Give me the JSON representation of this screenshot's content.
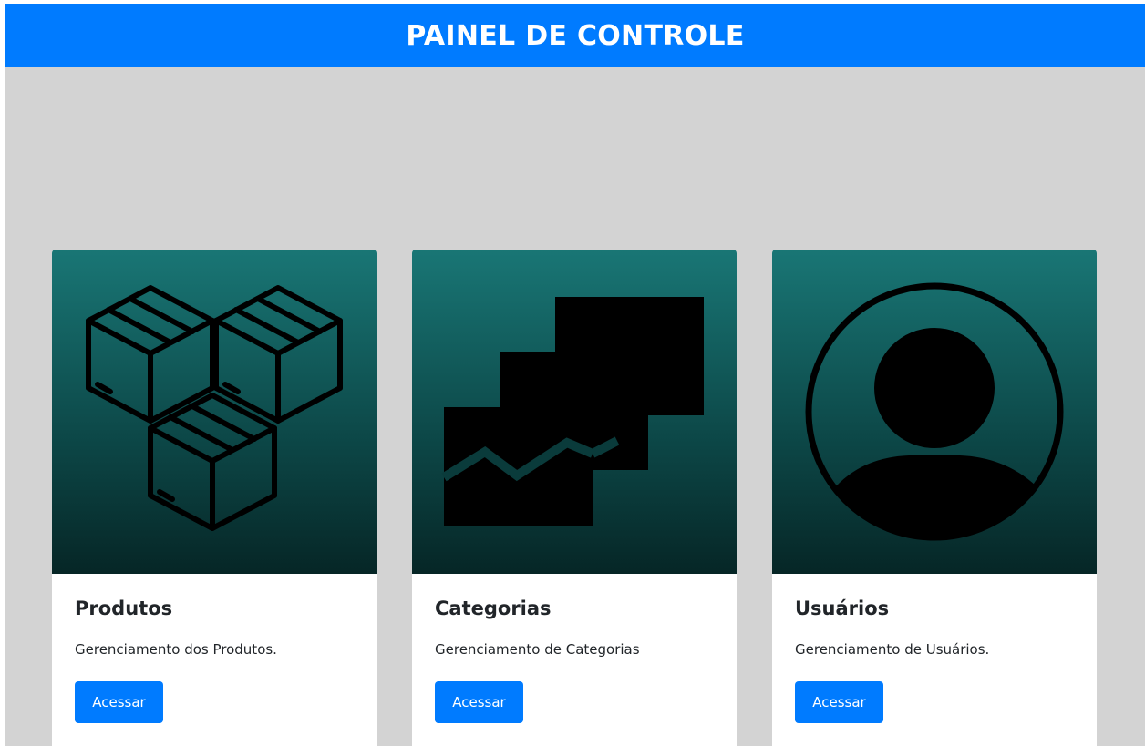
{
  "header": {
    "title": "PAINEL DE CONTROLE"
  },
  "colors": {
    "header": "#007bff",
    "background": "#d3d3d3",
    "button": "#007bff"
  },
  "cards": [
    {
      "icon": "boxes-icon",
      "title": "Produtos",
      "description": "Gerenciamento dos Produtos.",
      "button_label": "Acessar"
    },
    {
      "icon": "charts-stack-icon",
      "title": "Categorias",
      "description": "Gerenciamento de Categorias",
      "button_label": "Acessar"
    },
    {
      "icon": "user-circle-icon",
      "title": "Usuários",
      "description": "Gerenciamento de Usuários.",
      "button_label": "Acessar"
    }
  ]
}
